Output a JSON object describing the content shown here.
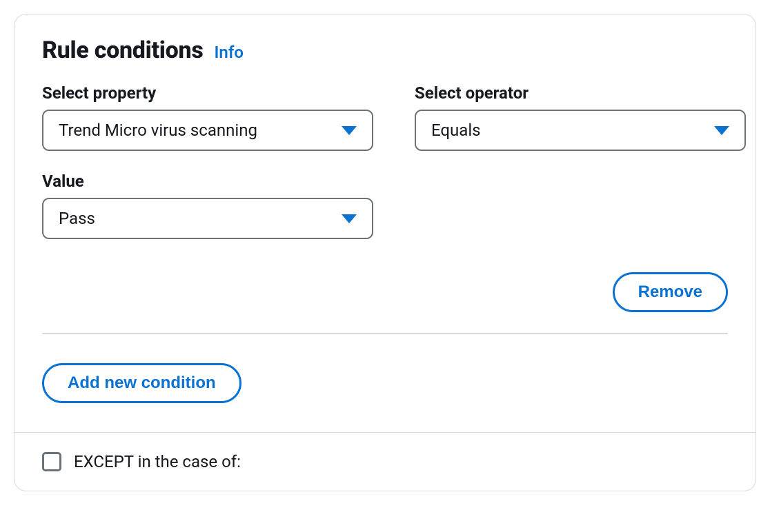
{
  "header": {
    "title": "Rule conditions",
    "info_label": "Info"
  },
  "fields": {
    "property": {
      "label": "Select property",
      "value": "Trend Micro virus scanning"
    },
    "operator": {
      "label": "Select operator",
      "value": "Equals"
    },
    "value": {
      "label": "Value",
      "value": "Pass"
    }
  },
  "buttons": {
    "remove": "Remove",
    "add_condition": "Add new condition"
  },
  "except": {
    "label": "EXCEPT in the case of:",
    "checked": false
  }
}
